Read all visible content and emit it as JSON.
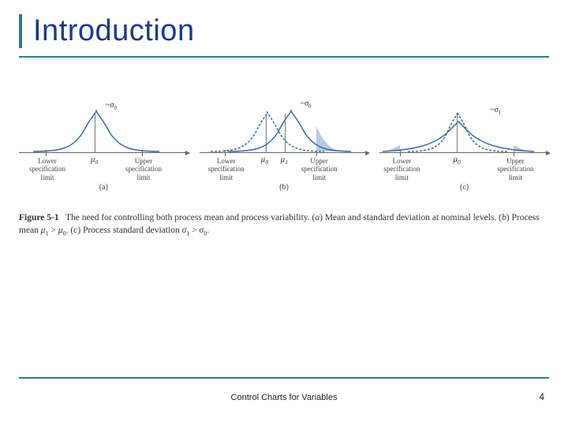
{
  "title": "Introduction",
  "footer": "Control Charts for Variables",
  "page": "4",
  "caption": {
    "figlabel": "Figure 5-1",
    "text_a": "The need for controlling both process mean and process variability. (",
    "part_a": "a",
    "text_b": ") Mean and standard deviation at nominal levels. (",
    "part_b": "b",
    "text_c": ") Process mean ",
    "mu1": "μ",
    "sub1": "1",
    "gt": " > ",
    "mu0": "μ",
    "sub0": "0",
    "text_d": ". (",
    "part_c": "c",
    "text_e": ") Process standard deviation ",
    "sig1": "σ",
    "ssub1": "1",
    "sgt": " > ",
    "sig0": "σ",
    "ssub0": "0",
    "text_f": "."
  },
  "labels": {
    "lsl1": "Lower",
    "lsl2": "specification",
    "lsl3": "limit",
    "usl1": "Upper",
    "usl2": "specification",
    "usl3": "limit",
    "mu0": "μ",
    "mu0s": "0",
    "mu1": "μ",
    "mu1s": "1",
    "sig0": "σ",
    "sig0s": "0",
    "sig1": "σ",
    "sig1s": "1",
    "pa": "(a)",
    "pb": "(b)",
    "pc": "(c)"
  },
  "chart_data": [
    {
      "type": "line",
      "title": "panel a",
      "lsl": 20,
      "usl": 80,
      "curves": [
        {
          "mean": 50,
          "sd": 12,
          "sigma_label": "σ0"
        }
      ],
      "xlabel_left": "Lower specification limit",
      "xlabel_center": "μ0",
      "xlabel_right": "Upper specification limit"
    },
    {
      "type": "line",
      "title": "panel b",
      "lsl": 22,
      "usl": 78,
      "curves": [
        {
          "mean": 46,
          "sd": 12,
          "sigma_label": "σ0",
          "dashed": true
        },
        {
          "mean": 60,
          "sd": 12,
          "sigma_label": "σ0"
        }
      ],
      "shade_right_of_usl": true,
      "xlabel_center": "μ0  μ1"
    },
    {
      "type": "line",
      "title": "panel c",
      "lsl": 18,
      "usl": 86,
      "curves": [
        {
          "mean": 50,
          "sd": 12,
          "sigma_label": "σ0",
          "dashed": true
        },
        {
          "mean": 50,
          "sd": 22,
          "sigma_label": "σ1"
        }
      ],
      "shade_both_tails": true,
      "xlabel_center": "μ0"
    }
  ]
}
